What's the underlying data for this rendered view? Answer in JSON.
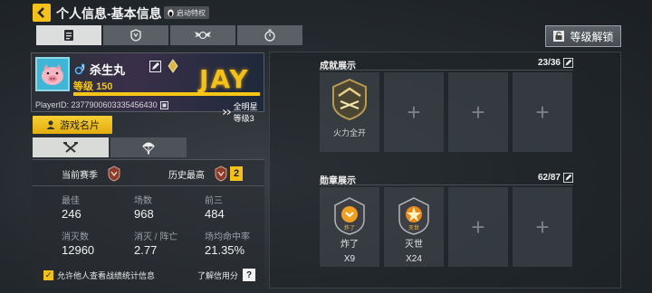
{
  "header": {
    "title": "个人信息-基本信息",
    "badge": "启动特权",
    "unlock_label": "等级解锁"
  },
  "tabs": [
    {
      "icon": "document-icon",
      "active": true
    },
    {
      "icon": "shield-icon",
      "active": false
    },
    {
      "icon": "wings-emblem-icon",
      "active": false
    },
    {
      "icon": "stopwatch-icon",
      "active": false
    }
  ],
  "profile": {
    "name": "杀生丸",
    "level_label": "等级",
    "level": "150",
    "level_progress": 1.0,
    "banner_text": "JAY",
    "player_id": "PlayerID: 2377900603335456430",
    "allstar": "全明星等级3",
    "namecard_button": "游戏名片"
  },
  "stats": {
    "current_season_label": "当前赛季",
    "history_high_label": "历史最高",
    "history_count": "2",
    "items": [
      {
        "label": "最佳",
        "value": "246"
      },
      {
        "label": "场数",
        "value": "968"
      },
      {
        "label": "前三",
        "value": "484"
      },
      {
        "label": "消灭数",
        "value": "12960"
      },
      {
        "label": "消灭 / 阵亡",
        "value": "2.77"
      },
      {
        "label": "场均命中率",
        "value": "21.35%"
      }
    ],
    "allow_label": "允许他人查看战绩统计信息",
    "credit_label": "了解信用分"
  },
  "achievements": {
    "title": "成就展示",
    "count": "23/36",
    "items": [
      {
        "name": "火力全开"
      }
    ]
  },
  "medals": {
    "title": "勋章展示",
    "count": "62/87",
    "items": [
      {
        "badge_text": "炸了",
        "name": "炸了",
        "count": "X9"
      },
      {
        "badge_text": "灭世",
        "name": "灭世",
        "count": "X24"
      }
    ]
  }
}
